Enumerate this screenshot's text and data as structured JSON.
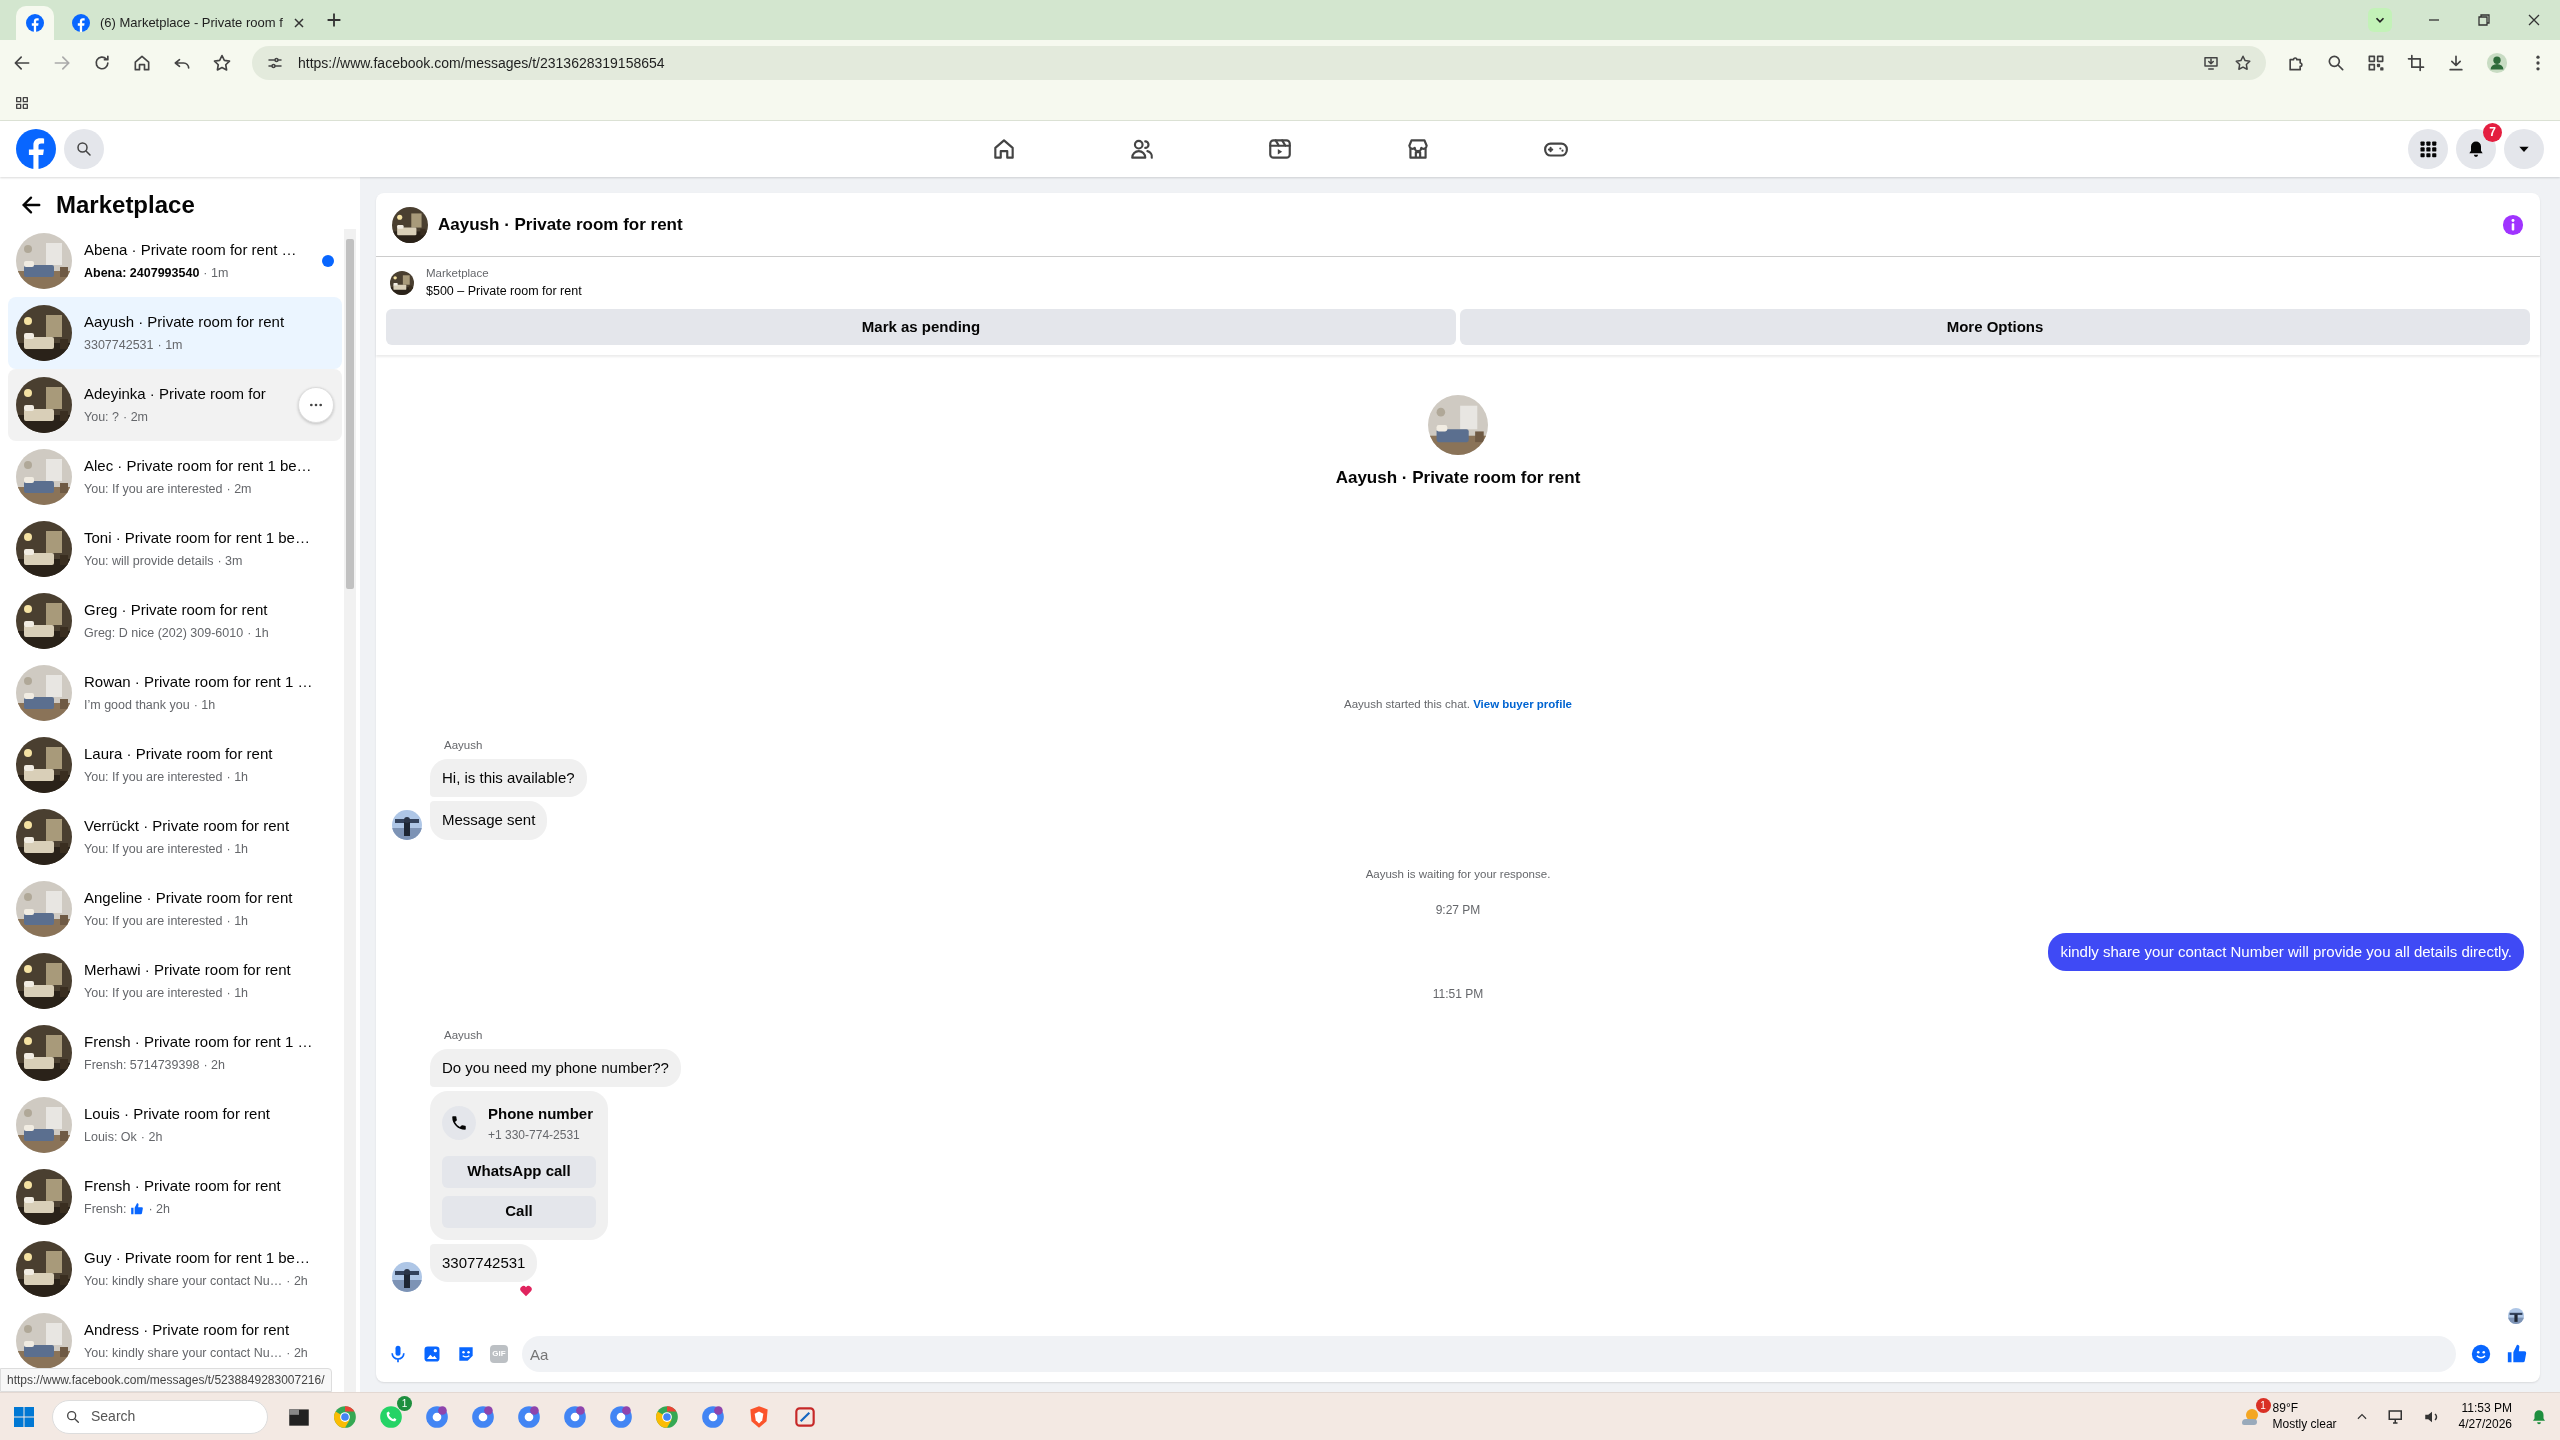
{
  "browser": {
    "tabs": [
      {
        "pinned": true,
        "selected": true
      },
      {
        "pinned": false,
        "title": "(6) Marketplace - Private room f",
        "selected": false
      }
    ],
    "url": "https://www.facebook.com/messages/t/2313628319158654"
  },
  "facebook_nav": {
    "items": [
      {
        "kind": "home",
        "selected": false
      },
      {
        "kind": "friends",
        "selected": false
      },
      {
        "kind": "video",
        "selected": false
      },
      {
        "kind": "marketplace",
        "selected": false
      },
      {
        "kind": "gaming",
        "selected": false
      }
    ],
    "notification_count": "7"
  },
  "sidebar": {
    "title": "Marketplace",
    "conversations": [
      {
        "title": "Abena · Private room for rent …",
        "preview": "Abena: 2407993540",
        "time": "· 1m",
        "unread": true,
        "selected": false,
        "hovered": false
      },
      {
        "title": "Aayush · Private room for rent",
        "preview": "3307742531",
        "time": "· 1m",
        "unread": false,
        "selected": true,
        "hovered": false
      },
      {
        "title": "Adeyinka · Private room for",
        "preview": "You: ?",
        "time": "· 2m",
        "unread": false,
        "selected": false,
        "hovered": true
      },
      {
        "title": "Alec · Private room for rent 1 be…",
        "preview": "You: If you are interested",
        "time": "· 2m",
        "unread": false,
        "selected": false,
        "hovered": false
      },
      {
        "title": "Toni · Private room for rent 1 be…",
        "preview": "You: will provide details",
        "time": "· 3m",
        "unread": false,
        "selected": false,
        "hovered": false
      },
      {
        "title": "Greg · Private room for rent",
        "preview": "Greg: D nice (202) 309-6010",
        "time": "· 1h",
        "unread": false,
        "selected": false,
        "hovered": false
      },
      {
        "title": "Rowan · Private room for rent 1 …",
        "preview": "I’m good thank you",
        "time": "· 1h",
        "unread": false,
        "selected": false,
        "hovered": false
      },
      {
        "title": "Laura · Private room for rent",
        "preview": "You: If you are interested",
        "time": "· 1h",
        "unread": false,
        "selected": false,
        "hovered": false
      },
      {
        "title": "Verrückt · Private room for rent",
        "preview": "You: If you are interested",
        "time": "· 1h",
        "unread": false,
        "selected": false,
        "hovered": false
      },
      {
        "title": "Angeline · Private room for rent",
        "preview": "You: If you are interested",
        "time": "· 1h",
        "unread": false,
        "selected": false,
        "hovered": false
      },
      {
        "title": "Merhawi · Private room for rent",
        "preview": "You: If you are interested",
        "time": "· 1h",
        "unread": false,
        "selected": false,
        "hovered": false
      },
      {
        "title": "Frensh · Private room for rent 1 …",
        "preview": "Frensh: 5714739398",
        "time": "· 2h",
        "unread": false,
        "selected": false,
        "hovered": false
      },
      {
        "title": "Louis · Private room for rent",
        "preview": "Louis: Ok",
        "time": "· 2h",
        "unread": false,
        "selected": false,
        "hovered": false
      },
      {
        "title": "Frensh · Private room for rent",
        "preview": "Frensh:",
        "like": true,
        "time": "· 2h",
        "unread": false,
        "selected": false,
        "hovered": false
      },
      {
        "title": "Guy · Private room for rent 1 be…",
        "preview": "You: kindly share your contact Nu…",
        "time": "· 2h",
        "unread": false,
        "selected": false,
        "hovered": false
      },
      {
        "title": "Andress · Private room for rent",
        "preview": "You: kindly share your contact Nu…",
        "time": "· 2h",
        "unread": false,
        "selected": false,
        "hovered": false
      }
    ]
  },
  "chat": {
    "title": "Aayush · Private room for rent",
    "listing": {
      "label": "Marketplace",
      "item": "$500 – Private room for rent"
    },
    "actions": [
      "Mark as pending",
      "More Options"
    ],
    "intro_name": "Aayush · Private room for rent",
    "started": {
      "text": "Aayush started this chat.",
      "link": "View buyer profile"
    },
    "messages": [
      {
        "kind": "sender",
        "text": "Aayush"
      },
      {
        "kind": "incoming",
        "text": "Hi, is this available?",
        "avatar": false
      },
      {
        "kind": "incoming",
        "text": "Message sent",
        "avatar": true
      },
      {
        "kind": "notice",
        "text": "Aayush is waiting for your response."
      },
      {
        "kind": "time",
        "text": "9:27 PM"
      },
      {
        "kind": "outgoing",
        "text": "kindly share your contact Number will provide you all details directly."
      },
      {
        "kind": "time",
        "text": "11:51 PM"
      },
      {
        "kind": "sender",
        "text": "Aayush"
      },
      {
        "kind": "incoming",
        "text": "Do you need my phone number??",
        "avatar": false
      },
      {
        "kind": "contact",
        "title": "Phone number",
        "number": "+1 330-774-2531",
        "buttons": [
          "WhatsApp call",
          "Call"
        ]
      },
      {
        "kind": "incoming",
        "text": "3307742531",
        "avatar": true,
        "reacted": true
      }
    ],
    "composer": {
      "placeholder": "Aa",
      "gif_label": "GIF"
    }
  },
  "status_url": "https://www.facebook.com/messages/t/5238849283007216/",
  "taskbar": {
    "search_placeholder": "Search",
    "apps": [
      {
        "kind": "files"
      },
      {
        "kind": "chrome"
      },
      {
        "kind": "whatsapp",
        "badge": "1"
      },
      {
        "kind": "profile"
      },
      {
        "kind": "profile"
      },
      {
        "kind": "profile"
      },
      {
        "kind": "profile"
      },
      {
        "kind": "profile"
      },
      {
        "kind": "chrome"
      },
      {
        "kind": "profile"
      },
      {
        "kind": "brave"
      },
      {
        "kind": "snip"
      }
    ],
    "weather": {
      "temp": "89°F",
      "condition": "Mostly clear",
      "badge": "1"
    },
    "time": "11:53 PM",
    "date": "4/27/2026"
  }
}
